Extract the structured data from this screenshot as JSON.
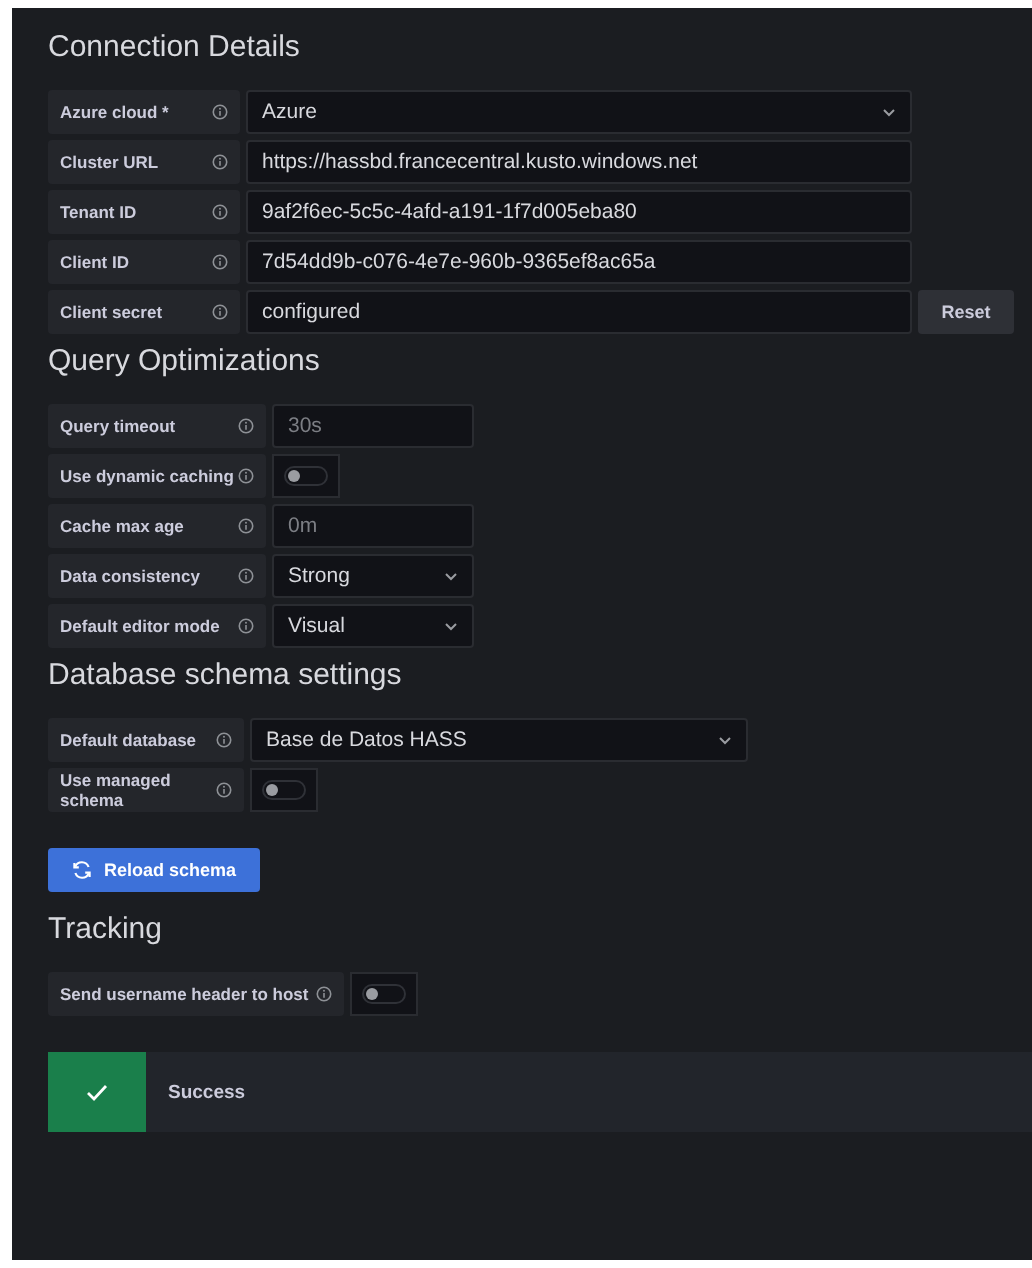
{
  "sections": [
    {
      "heading": "Connection Details",
      "rows": [
        {
          "label": "Azure cloud *",
          "kind": "select",
          "value": "Azure"
        },
        {
          "label": "Cluster URL",
          "kind": "input",
          "value": "https://hassbd.francecentral.kusto.windows.net"
        },
        {
          "label": "Tenant ID",
          "kind": "input",
          "value": "9af2f6ec-5c5c-4afd-a191-1f7d005eba80"
        },
        {
          "label": "Client ID",
          "kind": "input",
          "value": "7d54dd9b-c076-4e7e-960b-9365ef8ac65a"
        },
        {
          "label": "Client secret",
          "kind": "secret",
          "value": "configured",
          "button": "Reset"
        }
      ]
    },
    {
      "heading": "Query Optimizations",
      "rows": [
        {
          "label": "Query timeout",
          "kind": "input",
          "placeholder": "30s"
        },
        {
          "label": "Use dynamic caching",
          "kind": "toggle",
          "on": false
        },
        {
          "label": "Cache max age",
          "kind": "input",
          "placeholder": "0m"
        },
        {
          "label": "Data consistency",
          "kind": "select",
          "value": "Strong"
        },
        {
          "label": "Default editor mode",
          "kind": "select",
          "value": "Visual"
        }
      ]
    },
    {
      "heading": "Database schema settings",
      "rows": [
        {
          "label": "Default database",
          "kind": "select",
          "value": "Base de Datos HASS"
        },
        {
          "label": "Use managed schema",
          "kind": "toggle",
          "on": false
        }
      ],
      "button": "Reload schema"
    },
    {
      "heading": "Tracking",
      "rows": [
        {
          "label": "Send username header to host",
          "kind": "toggle",
          "on": false
        }
      ]
    }
  ],
  "alert": {
    "kind": "success",
    "text": "Success"
  }
}
